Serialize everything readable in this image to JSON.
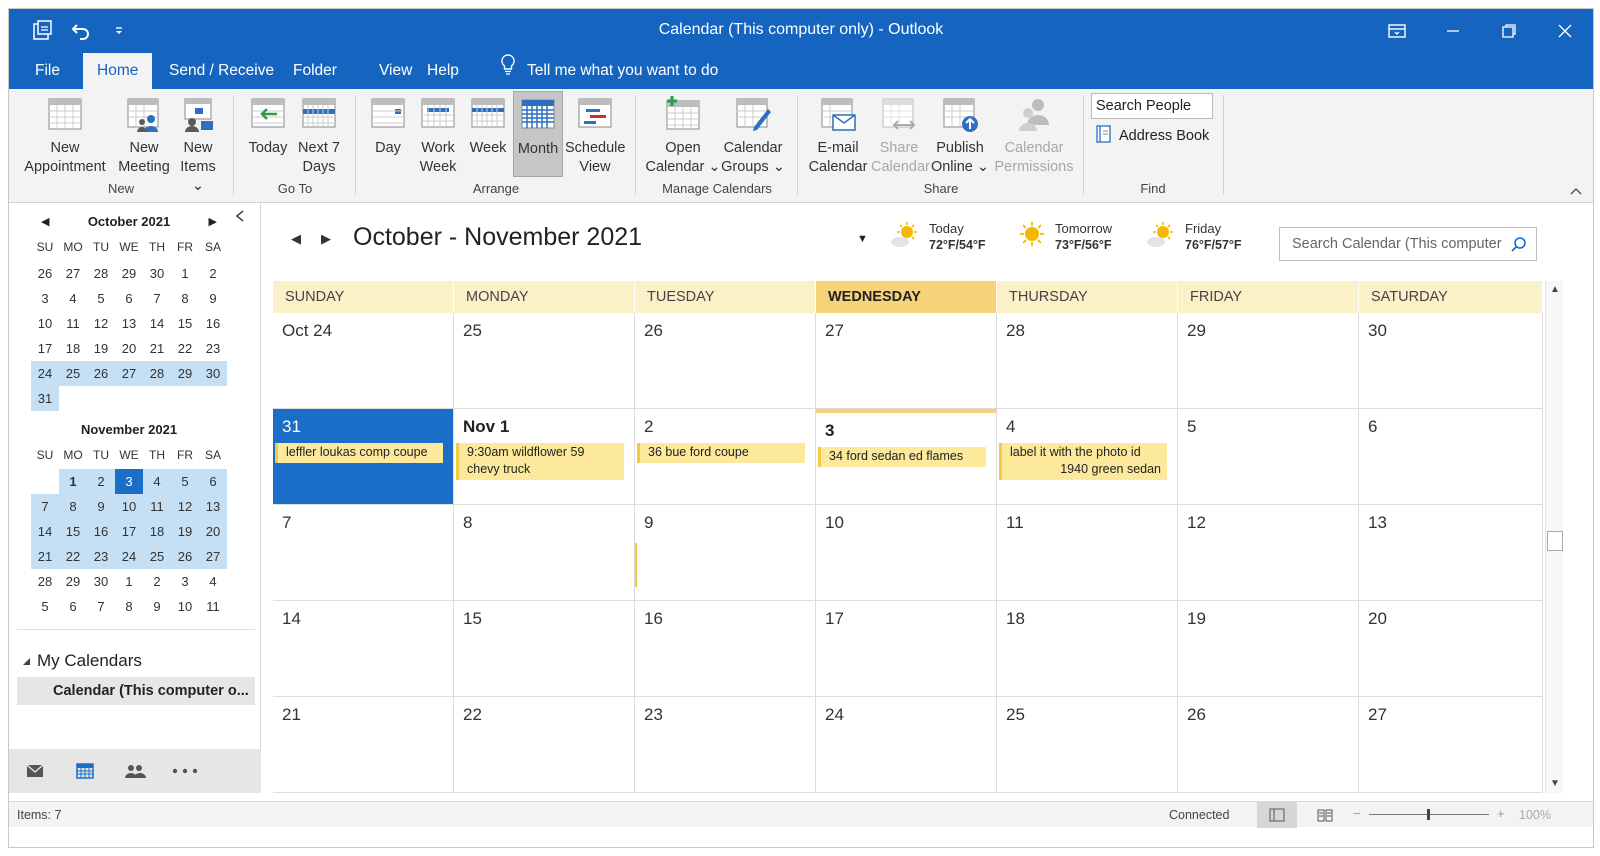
{
  "window": {
    "title": "Calendar (This computer only)  -  Outlook"
  },
  "tabs": [
    {
      "label": "File"
    },
    {
      "label": "Home"
    },
    {
      "label": "Send / Receive"
    },
    {
      "label": "Folder"
    },
    {
      "label": "View"
    },
    {
      "label": "Help"
    }
  ],
  "tell_me": "Tell me what you want to do",
  "ribbon": {
    "groups": {
      "new": "New",
      "goto": "Go To",
      "arrange": "Arrange",
      "manage": "Manage Calendars",
      "share": "Share",
      "find": "Find"
    },
    "buttons": {
      "new_appt_1": "New",
      "new_appt_2": "Appointment",
      "new_meet_1": "New",
      "new_meet_2": "Meeting",
      "new_items_1": "New",
      "new_items_2": "Items ⌄",
      "today": "Today",
      "next7_1": "Next 7",
      "next7_2": "Days",
      "day": "Day",
      "workweek_1": "Work",
      "workweek_2": "Week",
      "week": "Week",
      "month": "Month",
      "schedule_1": "Schedule",
      "schedule_2": "View",
      "open_1": "Open",
      "open_2": "Calendar ⌄",
      "groups_1": "Calendar",
      "groups_2": "Groups ⌄",
      "email_1": "E-mail",
      "email_2": "Calendar",
      "sharecal_1": "Share",
      "sharecal_2": "Calendar",
      "publish_1": "Publish",
      "publish_2": "Online ⌄",
      "perm_1": "Calendar",
      "perm_2": "Permissions"
    },
    "search_people": "Search People",
    "address_book": "Address Book"
  },
  "nav": {
    "october": {
      "title": "October 2021",
      "dows": [
        "SU",
        "MO",
        "TU",
        "WE",
        "TH",
        "FR",
        "SA"
      ],
      "weeks": [
        [
          "26",
          "27",
          "28",
          "29",
          "30",
          "1",
          "2"
        ],
        [
          "3",
          "4",
          "5",
          "6",
          "7",
          "8",
          "9"
        ],
        [
          "10",
          "11",
          "12",
          "13",
          "14",
          "15",
          "16"
        ],
        [
          "17",
          "18",
          "19",
          "20",
          "21",
          "22",
          "23"
        ],
        [
          "24",
          "25",
          "26",
          "27",
          "28",
          "29",
          "30"
        ],
        [
          "31",
          "",
          "",
          "",
          "",
          "",
          ""
        ]
      ]
    },
    "november": {
      "title": "November 2021",
      "dows": [
        "SU",
        "MO",
        "TU",
        "WE",
        "TH",
        "FR",
        "SA"
      ],
      "weeks": [
        [
          "",
          "1",
          "2",
          "3",
          "4",
          "5",
          "6"
        ],
        [
          "7",
          "8",
          "9",
          "10",
          "11",
          "12",
          "13"
        ],
        [
          "14",
          "15",
          "16",
          "17",
          "18",
          "19",
          "20"
        ],
        [
          "21",
          "22",
          "23",
          "24",
          "25",
          "26",
          "27"
        ],
        [
          "28",
          "29",
          "30",
          "1",
          "2",
          "3",
          "4"
        ],
        [
          "5",
          "6",
          "7",
          "8",
          "9",
          "10",
          "11"
        ]
      ]
    },
    "my_calendars": "My Calendars",
    "calendar_item": "Calendar (This computer o..."
  },
  "calendar": {
    "range_title": "October - November 2021",
    "weather": [
      {
        "label": "Today",
        "temp": "72°F/54°F"
      },
      {
        "label": "Tomorrow",
        "temp": "73°F/56°F"
      },
      {
        "label": "Friday",
        "temp": "76°F/57°F"
      }
    ],
    "search_placeholder": "Search Calendar (This computer",
    "days_of_week": [
      "SUNDAY",
      "MONDAY",
      "TUESDAY",
      "WEDNESDAY",
      "THURSDAY",
      "FRIDAY",
      "SATURDAY"
    ],
    "weeks": [
      [
        "Oct 24",
        "25",
        "26",
        "27",
        "28",
        "29",
        "30"
      ],
      [
        "31",
        "Nov 1",
        "2",
        "3",
        "4",
        "5",
        "6"
      ],
      [
        "7",
        "8",
        "9",
        "10",
        "11",
        "12",
        "13"
      ],
      [
        "14",
        "15",
        "16",
        "17",
        "18",
        "19",
        "20"
      ],
      [
        "21",
        "22",
        "23",
        "24",
        "25",
        "26",
        "27"
      ]
    ],
    "events": {
      "sun31": "leffler loukas comp coupe",
      "mon1_a": "9:30am wildflower 59",
      "mon1_b": "chevy truck",
      "tue2": "36 bue ford coupe",
      "wed3": "34 ford sedan ed flames",
      "thu4_a": "label it with the photo id",
      "thu4_b": "1940 green sedan"
    }
  },
  "status": {
    "items": "Items: 7",
    "connection": "Connected",
    "zoom": "100%"
  },
  "colors": {
    "accent": "#1565c0",
    "selected_day": "#1a6ec8",
    "day_header": "#fbf1c9",
    "today_header": "#f6d27a",
    "event": "#fce99c",
    "mini_highlight": "#c5dff4"
  }
}
